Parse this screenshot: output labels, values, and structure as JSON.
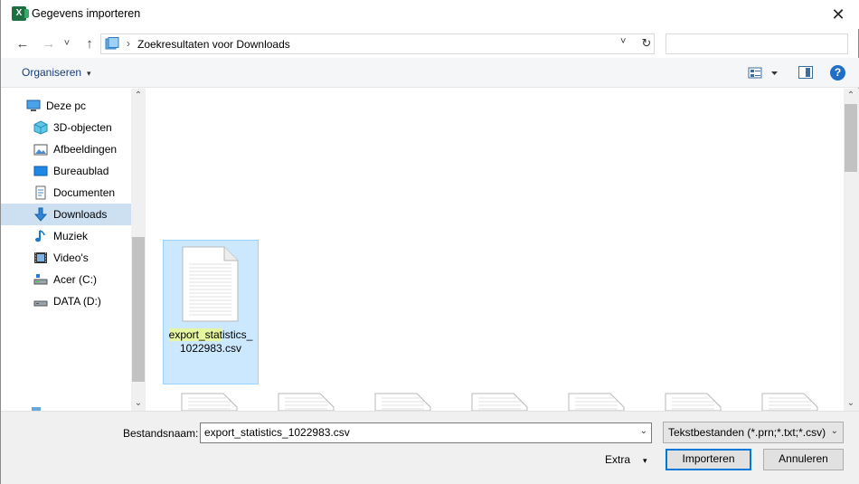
{
  "window": {
    "title": "Gegevens importeren",
    "app_icon_letter": "X",
    "close_glyph": "✕"
  },
  "nav": {
    "back_glyph": "←",
    "forward_glyph": "→",
    "recent_glyph": "˅",
    "up_glyph": "↑",
    "breadcrumb_sep": "›",
    "path": "Zoekresultaten voor Downloads",
    "address_dropdown_glyph": "˅",
    "refresh_glyph": "↻",
    "search_value": ""
  },
  "toolbar": {
    "organize_label": "Organiseren",
    "caret": "▾",
    "help_glyph": "?"
  },
  "sidebar": {
    "items": [
      {
        "label": "Deze pc",
        "icon": "computer-icon"
      },
      {
        "label": "3D-objecten",
        "icon": "cube-icon"
      },
      {
        "label": "Afbeeldingen",
        "icon": "pictures-icon"
      },
      {
        "label": "Bureaublad",
        "icon": "desktop-icon"
      },
      {
        "label": "Documenten",
        "icon": "documents-icon"
      },
      {
        "label": "Downloads",
        "icon": "download-icon",
        "selected": true
      },
      {
        "label": "Muziek",
        "icon": "music-icon"
      },
      {
        "label": "Video's",
        "icon": "video-icon"
      },
      {
        "label": "Acer (C:)",
        "icon": "drive-icon"
      },
      {
        "label": "DATA (D:)",
        "icon": "drive-icon"
      }
    ],
    "scroll_up_glyph": "⌃",
    "scroll_down_glyph": "⌄"
  },
  "content": {
    "selected_file": {
      "name_highlight": "export_stat",
      "name_rest_line1": "istics_",
      "name_line2": "1022983.csv"
    }
  },
  "footer": {
    "filename_label": "Bestandsnaam:",
    "filename_value": "export_statistics_1022983.csv",
    "filetype_value": "Tekstbestanden (*.prn;*.txt;*.csv)",
    "dropdown_glyph": "⌄",
    "extra_label": "Extra",
    "extra_caret": "▾",
    "import_label": "Importeren",
    "cancel_label": "Annuleren"
  },
  "colors": {
    "accent": "#0078d7",
    "selection": "#cce8ff",
    "excel_green": "#1d6f42"
  }
}
